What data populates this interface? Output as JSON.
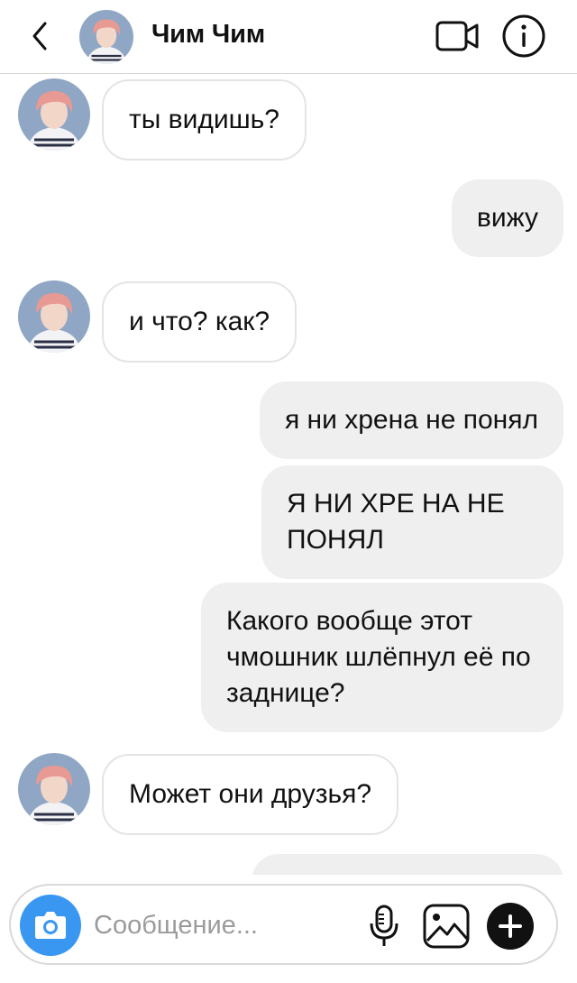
{
  "header": {
    "title": "Чим Чим",
    "icons": {
      "back": "chevron-left-icon",
      "video": "video-camera-icon",
      "info": "info-icon"
    }
  },
  "messages": [
    {
      "side": "in",
      "text": "ты видишь?"
    },
    {
      "side": "out",
      "text": "вижу"
    },
    {
      "side": "in",
      "text": "и что? как?"
    },
    {
      "side": "out",
      "text": "я ни хрена не понял"
    },
    {
      "side": "out",
      "text": "Я НИ ХРЕ НА НЕ ПОНЯЛ"
    },
    {
      "side": "out",
      "text": "Какого вообще этот чмошник шлёпнул её по заднице?"
    },
    {
      "side": "in",
      "text": "Может они друзья?"
    },
    {
      "side": "out",
      "text": ""
    }
  ],
  "composer": {
    "placeholder": "Сообщение...",
    "value": "",
    "icons": {
      "camera": "camera-icon",
      "mic": "microphone-icon",
      "gallery": "image-icon",
      "add": "plus-icon"
    }
  },
  "colors": {
    "accent": "#3a97f1",
    "outgoing_bubble": "#efefef",
    "incoming_border": "#e4e4e4",
    "avatar_bg": "#8fa6c4",
    "hair": "#e79a93"
  }
}
